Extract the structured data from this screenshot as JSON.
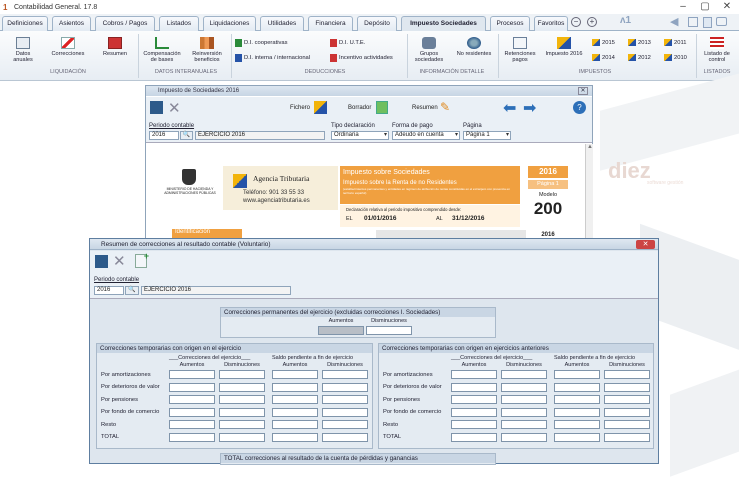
{
  "app": {
    "title": "Contabilidad General. 17.8"
  },
  "tabs": [
    "Definiciones",
    "Asientos",
    "Cobros / Pagos",
    "Listados",
    "Liquidaciones",
    "Utilidades",
    "Financiera",
    "Depósito",
    "Impuesto Sociedades",
    "Procesos",
    "Favoritos"
  ],
  "ribbon": {
    "datos_anuales": "Datos anuales",
    "correcciones": "Correcciones",
    "resumen": "Resumen",
    "compensacion": "Compensación de bases",
    "reinversion": "Reinversión beneficios",
    "di_coop": "D.I. cooperativas",
    "di_interna": "D.I. interna / internacional",
    "di_ute": "D.I. U.T.E.",
    "incentivo": "Incentivo actividades",
    "grupos": "Grupos sociedades",
    "no_residentes": "No residentes",
    "retenciones": "Retenciones pagos",
    "impuesto2016": "Impuesto 2016",
    "y2015": "2015",
    "y2014": "2014",
    "y2013": "2013",
    "y2012": "2012",
    "y2011": "2011",
    "y2010": "2010",
    "listado": "Listado de control",
    "groups": {
      "liquidacion": "LIQUIDACIÓN",
      "datos_intern": "DATOS INTERANUALES",
      "deducciones": "DEDUCCIONES",
      "info": "INFORMACIÓN DETALLE",
      "impuestos": "IMPUESTOS",
      "listados": "LISTADOS"
    }
  },
  "brand": {
    "logo": "diez",
    "tagline": "software gestión"
  },
  "win1": {
    "title": "Impuesto de Sociedades 2016",
    "fichero": "Fichero",
    "borrador": "Borrador",
    "resumen": "Resumen",
    "periodo_label": "Periodo contable",
    "periodo_value": "2016",
    "periodo_desc": "EJERCICIO 2016",
    "tipo_label": "Tipo declaración",
    "tipo_value": "Ordinaria",
    "forma_label": "Forma de pago",
    "forma_value": "Adeudo en cuenta",
    "pagina_label": "Página",
    "pagina_value": "Página 1",
    "ministerio": "MINISTERIO DE HACIENDA Y ADMINISTRACIONES PÚBLICAS",
    "agencia": "Agencia Tributaria",
    "telefono": "Teléfono: 901 33 55 33",
    "web": "www.agenciatributaria.es",
    "is_title": "Impuesto sobre Sociedades",
    "is_sub": "Impuesto sobre la Renta de no Residentes",
    "is_small": "(establecimientos permanentes y entidades en régimen de atribución de rentas constituidas en el extranjero con presencia en territorio español)",
    "year": "2016",
    "pagina1": "Página 1",
    "modelo": "Modelo",
    "modelo_num": "200",
    "decl": "Declaración relativa al periodo impositivo comprendido desde:",
    "el": "EL",
    "desde": "01/01/2016",
    "al": "AL",
    "hasta": "31/12/2016",
    "identificacion": "Identificación",
    "year2": "2016"
  },
  "win2": {
    "title": "Resumen de correcciones al resultado contable (Voluntario)",
    "periodo_label": "Periodo contable",
    "periodo_value": "2016",
    "periodo_desc": "EJERCICIO 2016",
    "perm_title": "Correcciones permanentes del ejercicio (excluidas correcciones I. Sociedades)",
    "aumentos": "Aumentos",
    "disminuciones": "Disminuciones",
    "temp1_title": "Correcciones temporarias con origen en el ejercicio",
    "temp2_title": "Correcciones temporarias con origen en ejercicios anteriores",
    "corr_ejercicio": "___Correcciones del ejercicio___",
    "saldo_pend": "Saldo pendiente a fin de ejercicio",
    "rows": [
      "Por amortizaciones",
      "Por deterioros de valor",
      "Por pensiones",
      "Por fondo de comercio",
      "Resto",
      "TOTAL"
    ],
    "total_title": "TOTAL correcciones al resultado de la cuenta de pérdidas y ganancias"
  }
}
